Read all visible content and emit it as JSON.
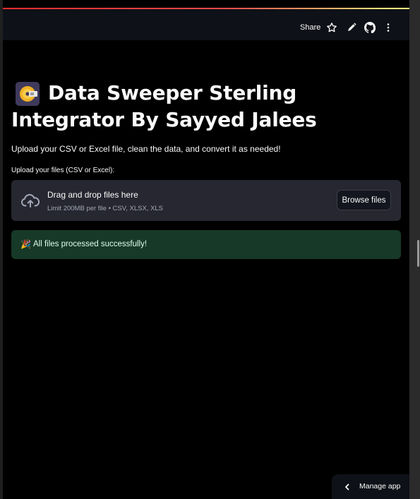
{
  "header": {
    "share_label": "Share",
    "icons": [
      "star-icon",
      "pencil-icon",
      "github-icon",
      "more-vertical-icon"
    ]
  },
  "main": {
    "title_icon": "minidisc-icon",
    "title": "Data Sweeper Sterling Integrator By Sayyed Jalees",
    "subtitle": "Upload your CSV or Excel file, clean the data, and convert it as needed!",
    "uploader": {
      "label": "Upload your files (CSV or Excel):",
      "dropzone_title": "Drag and drop files here",
      "limit_text": "Limit 200MB per file • CSV, XLSX, XLS",
      "browse_label": "Browse files"
    },
    "success": {
      "emoji": "🎉",
      "message": "All files processed successfully!"
    }
  },
  "footer": {
    "manage_app_label": "Manage app"
  },
  "colors": {
    "background": "#000000",
    "header": "#0e1117",
    "dropzone": "#262730",
    "success_bg": "#173928",
    "success_text": "#dffde9",
    "accent_red": "#ff4b4b"
  }
}
